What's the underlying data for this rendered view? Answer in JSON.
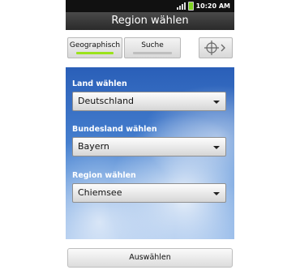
{
  "status_bar": {
    "time": "10:20 AM",
    "icons": [
      "signal-icon",
      "battery-icon"
    ]
  },
  "title": "Region wählen",
  "tabs": [
    {
      "label": "Geographisch",
      "selected": true,
      "indicator_color": "#9be31c"
    },
    {
      "label": "Suche",
      "selected": false,
      "indicator_color": "#bfbfbf"
    }
  ],
  "locate_button": {
    "icon": "crosshair-icon",
    "secondary_icon": "chevron-right-icon"
  },
  "fields": [
    {
      "label": "Land wählen",
      "value": "Deutschland"
    },
    {
      "label": "Bundesland wählen",
      "value": "Bayern"
    },
    {
      "label": "Region wählen",
      "value": "Chiemsee"
    }
  ],
  "submit_label": "Auswählen",
  "colors": {
    "title_bar": "#2f2f2f",
    "sky": "#3d74c8",
    "accent_green": "#9be31c"
  }
}
